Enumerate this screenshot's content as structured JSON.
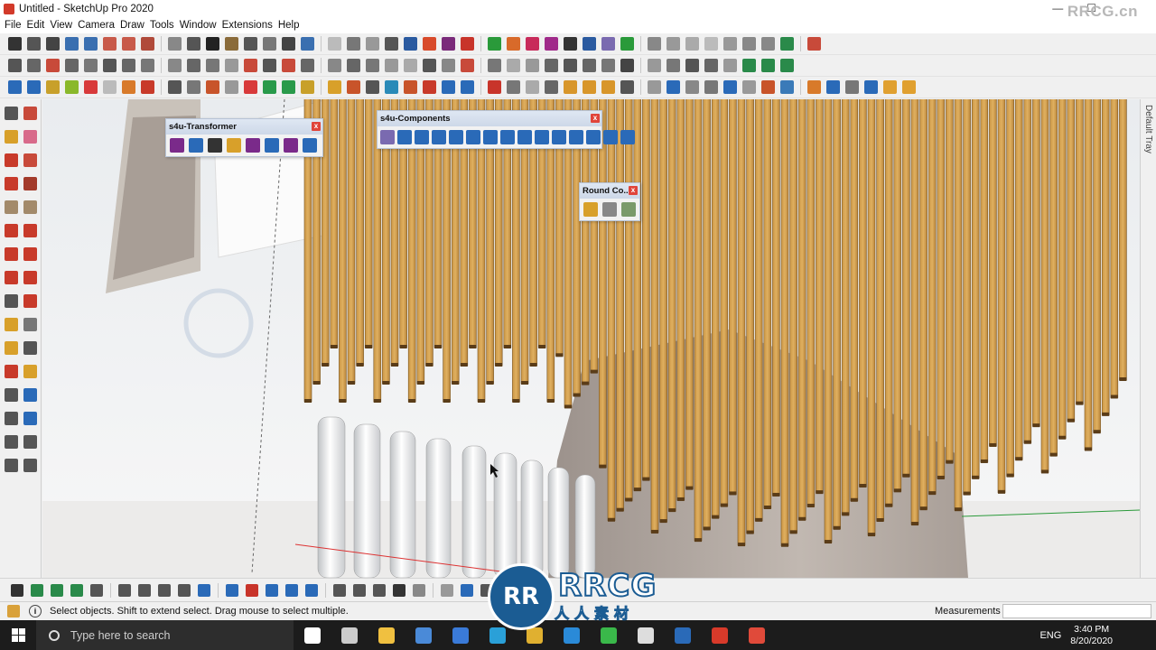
{
  "window": {
    "title": "Untitled - SketchUp Pro 2020",
    "watermark_top": "RRCG.cn",
    "min_symbol": "—",
    "max_symbol": "☐"
  },
  "menu": [
    "File",
    "Edit",
    "View",
    "Camera",
    "Draw",
    "Tools",
    "Window",
    "Extensions",
    "Help"
  ],
  "toolbar_colors": {
    "row1": [
      "#333",
      "#555",
      "#444",
      "#3a6fb0",
      "#3a6fb0",
      "#c85a4a",
      "#c85a4a",
      "#b04a3a",
      "#888",
      "#555",
      "#222",
      "#8a6b3a",
      "#555",
      "#777",
      "#444",
      "#3a6fb0",
      "#bbb",
      "#777",
      "#999",
      "#555",
      "#2a5aa0",
      "#d84a2a",
      "#7a2a7a",
      "#c8342a",
      "#2a9a3a",
      "#d86a2a",
      "#c82a5a",
      "#a02a8a",
      "#333",
      "#2a5aa0",
      "#7a6ab0",
      "#2a9a3a",
      "#888",
      "#999",
      "#aaa",
      "#bbb",
      "#999",
      "#888",
      "#888",
      "#2a8a4a",
      "#c84a3a"
    ],
    "row2": [
      "#555",
      "#666",
      "#c84a3a",
      "#666",
      "#777",
      "#555",
      "#666",
      "#777",
      "#888",
      "#666",
      "#777",
      "#999",
      "#c84a3a",
      "#555",
      "#c84a3a",
      "#666",
      "#888",
      "#666",
      "#777",
      "#999",
      "#aaa",
      "#555",
      "#888",
      "#c84a3a",
      "#777",
      "#aaa",
      "#999",
      "#666",
      "#555",
      "#666",
      "#777",
      "#444",
      "#999",
      "#777",
      "#555",
      "#666",
      "#999",
      "#2a8a4a",
      "#2a8a4a",
      "#2a8a4a"
    ],
    "row3": [
      "#2a6ab8",
      "#2a6ab8",
      "#c8a02a",
      "#8ab82a",
      "#d83a3a",
      "#bbb",
      "#d87a2a",
      "#c83a2a",
      "#555",
      "#777",
      "#c8542a",
      "#999",
      "#d83a3a",
      "#2a9a4a",
      "#2a9a4a",
      "#c8a02a",
      "#d8a02a",
      "#c8542a",
      "#555",
      "#2a8ab8",
      "#c8542a",
      "#c83a2a",
      "#2a6ab8",
      "#2a6ab8",
      "#c8342a",
      "#777",
      "#aaa",
      "#666",
      "#d8962a",
      "#d8962a",
      "#d8962a",
      "#555",
      "#999",
      "#2a6ab8",
      "#888",
      "#777",
      "#2a6ab8",
      "#999",
      "#c8542a",
      "#3a7ab8",
      "#d87a2a",
      "#2a6ab8",
      "#777",
      "#2a6ab8",
      "#e0a030",
      "#e0a030"
    ]
  },
  "left_tool_colors": [
    "#555",
    "#c84a3a",
    "#d8a02a",
    "#d86a8a",
    "#c83a2a",
    "#c84a3a",
    "#c83a2a",
    "#a33a2a",
    "#a38a6a",
    "#a38a6a",
    "#c83a2a",
    "#c83a2a",
    "#c83a2a",
    "#c83a2a",
    "#c83a2a",
    "#c83a2a",
    "#555",
    "#c83a2a",
    "#d8a02a",
    "#777",
    "#d8a02a",
    "#555",
    "#c83a2a",
    "#d8a02a",
    "#555",
    "#2a6ab8",
    "#555",
    "#2a6ab8",
    "#555",
    "#555",
    "#555",
    "#555"
  ],
  "floating_toolbars": {
    "transformer": {
      "title": "s4u-Transformer",
      "close": "x",
      "icon_colors": [
        "#7a2a8a",
        "#2a6ab8",
        "#333",
        "#d8a02a",
        "#7a2a8a",
        "#2a6ab8",
        "#7a2a8a",
        "#2a6ab8"
      ]
    },
    "components": {
      "title": "s4u-Components",
      "close": "x",
      "icon_colors": [
        "#7a6ab0",
        "#2a6ab8",
        "#2a6ab8",
        "#2a6ab8",
        "#2a6ab8",
        "#2a6ab8",
        "#2a6ab8",
        "#2a6ab8",
        "#2a6ab8",
        "#2a6ab8",
        "#2a6ab8",
        "#2a6ab8",
        "#2a6ab8",
        "#2a6ab8",
        "#2a6ab8"
      ]
    },
    "round_corner": {
      "title": "Round Co...",
      "close": "x",
      "icon_colors": [
        "#d8a02a",
        "#888",
        "#7a9a6a"
      ]
    }
  },
  "bottom_toolbar_colors": [
    "#333",
    "#2a8a4a",
    "#2a8a4a",
    "#2a8a4a",
    "#555",
    "#555",
    "#555",
    "#555",
    "#555",
    "#2a6ab8",
    "#2a6ab8",
    "#c8342a",
    "#2a6ab8",
    "#2a6ab8",
    "#2a6ab8",
    "#555",
    "#555",
    "#555",
    "#333",
    "#888",
    "#999",
    "#2a6ab8",
    "#555"
  ],
  "status": {
    "hint": "Select objects. Shift to extend select. Drag mouse to select multiple.",
    "info_glyph": "i",
    "measurements_label": "Measurements",
    "measurements_value": ""
  },
  "tray": {
    "label": "Default Tray"
  },
  "taskbar": {
    "search_placeholder": "Type here to search",
    "apps": [
      {
        "name": "task-view",
        "color": "#ffffff"
      },
      {
        "name": "task-manager",
        "color": "#cccccc"
      },
      {
        "name": "file-explorer",
        "color": "#f0c040"
      },
      {
        "name": "store",
        "color": "#4a8ad8"
      },
      {
        "name": "mail",
        "color": "#3a7ad8"
      },
      {
        "name": "telegram",
        "color": "#2aa0d8"
      },
      {
        "name": "chrome",
        "color": "#e0b030"
      },
      {
        "name": "edge",
        "color": "#2a8ad8"
      },
      {
        "name": "camtasia",
        "color": "#3ab84a"
      },
      {
        "name": "pdf-app",
        "color": "#dddddd"
      },
      {
        "name": "photos",
        "color": "#2a6ab8"
      },
      {
        "name": "sketchup",
        "color": "#d83a2a"
      },
      {
        "name": "sketchup-layout",
        "color": "#e04a3a"
      }
    ],
    "language": "ENG",
    "time": "3:40 PM",
    "date": "8/20/2020"
  },
  "watermark": {
    "badge": "RR",
    "text": "RRCG",
    "sub": "人人素材"
  }
}
